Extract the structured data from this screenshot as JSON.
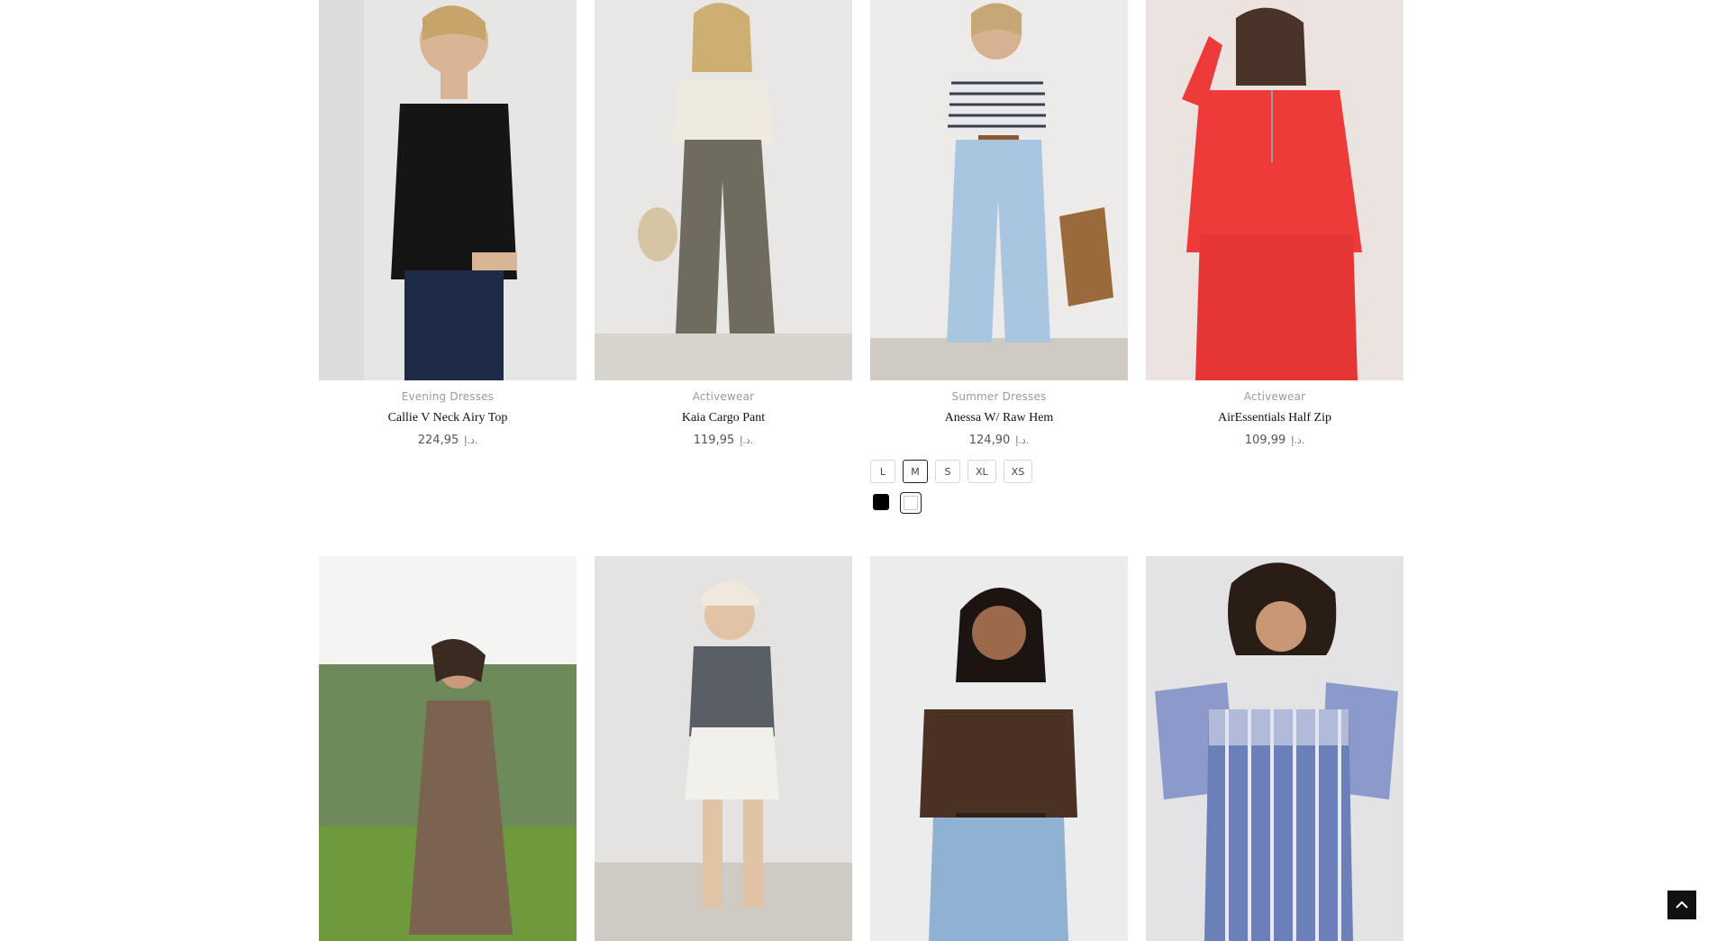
{
  "products": [
    {
      "category": "Evening Dresses",
      "name": "Callie V Neck Airy Top",
      "price": "224,95",
      "currency": "د.إ.",
      "image_colors": {
        "bg": "#e6e6e4",
        "top": "#151515",
        "bottom": "#1e2b46",
        "skin": "#d9b595"
      }
    },
    {
      "category": "Activewear",
      "name": "Kaia Cargo Pant",
      "price": "119,95",
      "currency": "د.إ.",
      "image_colors": {
        "bg": "#e8e7e6",
        "top": "#efeae0",
        "bottom": "#6f6c5f",
        "skin": "#dcc0a0"
      }
    },
    {
      "category": "Summer Dresses",
      "name": "Anessa W/ Raw Hem",
      "price": "124,90",
      "currency": "د.إ.",
      "image_colors": {
        "bg": "#ecebea",
        "top": "#e9e9ec",
        "bottom": "#a9c6e0",
        "skin": "#d6b290"
      },
      "sizes": [
        "L",
        "M",
        "S",
        "XL",
        "XS"
      ],
      "selected_size": "M",
      "colors": [
        "#000000",
        "#ffffff"
      ]
    },
    {
      "category": "Activewear",
      "name": "AirEssentials Half Zip",
      "price": "109,99",
      "currency": "د.إ.",
      "image_colors": {
        "bg": "#ebe3e0",
        "top": "#ef3a3a",
        "bottom": "#e63535",
        "skin": "#d4a98a"
      }
    }
  ],
  "row2_products": [
    {
      "image_colors": {
        "bg": "#eeeeee",
        "top": "#7a6450",
        "bottom": "#6b5545",
        "skin": "#c99b7a"
      }
    },
    {
      "image_colors": {
        "bg": "#e5e3e2",
        "top": "#5a5f66",
        "bottom": "#f2f0ea",
        "skin": "#e1c3a5"
      }
    },
    {
      "image_colors": {
        "bg": "#ececec",
        "top": "#4b3124",
        "bottom": "#8fb2d2",
        "skin": "#9c6a4a"
      }
    },
    {
      "image_colors": {
        "bg": "#e3e2e4",
        "top": "#6b7fb8",
        "bottom": "#6b7fb8",
        "skin": "#c89775"
      }
    }
  ],
  "ui": {
    "scroll_top_icon": "chevron-up-icon"
  }
}
